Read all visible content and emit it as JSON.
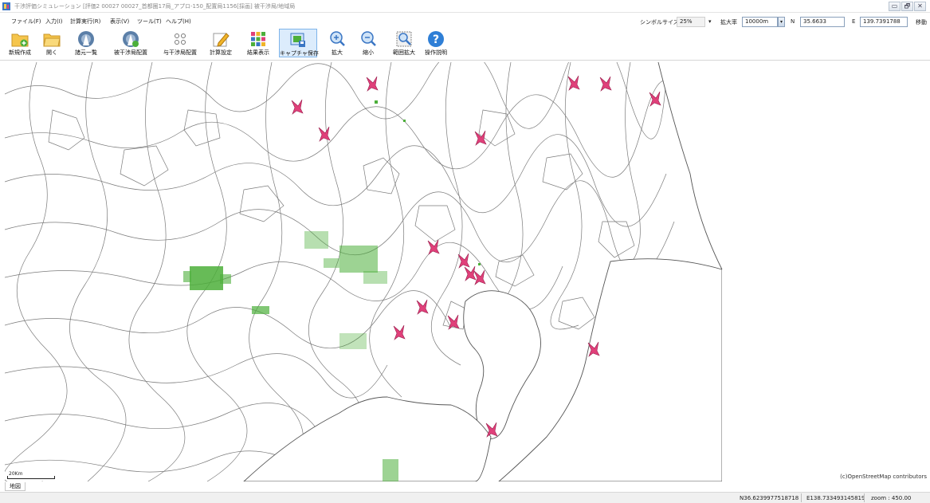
{
  "window": {
    "title": "干渉評価シミュレーション [評価2 00027 00027_首都圏17局_アプロ-150_配置局1156[採画] 被干渉局/地域局",
    "minimize": "▭",
    "maximize": "🗗",
    "close": "✕"
  },
  "menu": {
    "items": [
      "ファイル(F)",
      "入力(I)",
      "計算実行(R)",
      "表示(V)",
      "ツール(T)",
      "ヘルプ(H)"
    ]
  },
  "view_controls": {
    "symbol_size_label": "シンボルサイズ",
    "symbol_size_value": "25%",
    "zoom_label": "拡大率",
    "zoom_value": "10000m",
    "n_label": "N",
    "n_value": "35.6633",
    "e_label": "E",
    "e_value": "139.7391788",
    "move_button": "移動"
  },
  "toolbar": {
    "buttons": [
      {
        "label": "新規作成",
        "icon": "new-folder-icon"
      },
      {
        "label": "開く",
        "icon": "open-folder-icon"
      },
      {
        "label": "諸元一覧",
        "icon": "station-list-icon"
      },
      {
        "label": "被干渉局配置",
        "icon": "victim-station-icon"
      },
      {
        "label": "与干渉局配置",
        "icon": "interferer-station-icon"
      },
      {
        "label": "計算設定",
        "icon": "settings-pencil-icon"
      },
      {
        "label": "結果表示",
        "icon": "result-grid-icon"
      },
      {
        "label": "キャプチャ保存",
        "icon": "capture-save-icon"
      },
      {
        "label": "拡大",
        "icon": "zoom-in-icon"
      },
      {
        "label": "縮小",
        "icon": "zoom-out-icon"
      },
      {
        "label": "範囲拡大",
        "icon": "zoom-area-icon"
      },
      {
        "label": "操作説明",
        "icon": "help-icon"
      }
    ],
    "active_index": 7
  },
  "map": {
    "scale_label": "20Km",
    "attribution": "(c)OpenStreetMap contributors",
    "station_marker_color": "#e0407a",
    "coverage_color": "#4caf3a",
    "boundary_color": "#7a7a7a"
  },
  "tabs": {
    "map_tab": "地図"
  },
  "status": {
    "lat": "N36.6239977518718",
    "lon": "E138.733493145819",
    "zoom": "zoom : 450.00"
  }
}
